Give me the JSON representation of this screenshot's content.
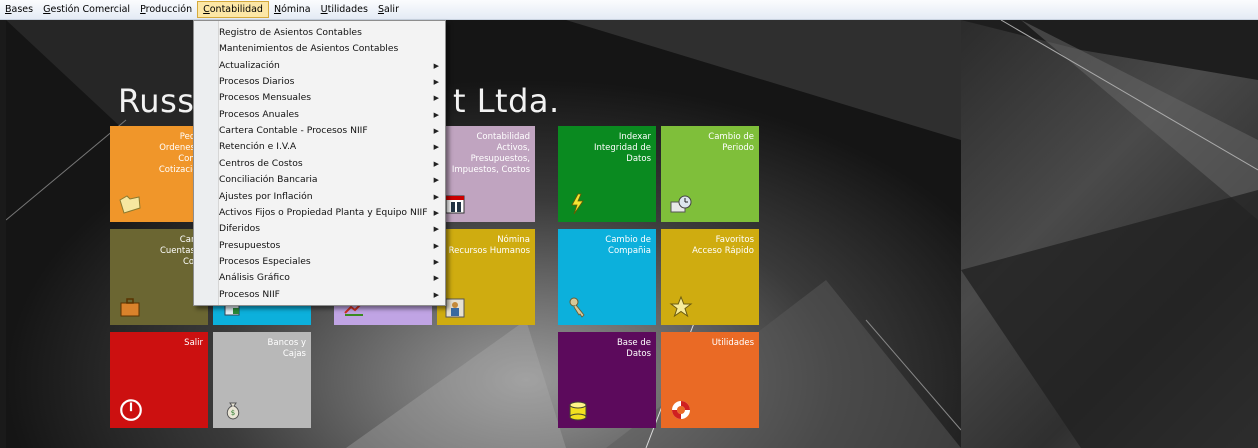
{
  "menubar": {
    "items": [
      {
        "label": "Bases",
        "key": "B"
      },
      {
        "label": "Gestión Comercial",
        "key": "G"
      },
      {
        "label": "Producción",
        "key": "P"
      },
      {
        "label": "Contabilidad",
        "key": "C"
      },
      {
        "label": "Nómina",
        "key": "N"
      },
      {
        "label": "Utilidades",
        "key": "U"
      },
      {
        "label": "Salir",
        "key": "S"
      }
    ],
    "active_index": 3
  },
  "company": {
    "title_visible_left": "Russo",
    "title_visible_right": "t Ltda."
  },
  "contabilidad_menu": {
    "items": [
      {
        "label": "Registro de Asientos Contables",
        "submenu": false
      },
      {
        "label": "Mantenimientos de Asientos Contables",
        "submenu": false
      },
      {
        "label": "Actualización",
        "submenu": true
      },
      {
        "label": "Procesos Diarios",
        "submenu": true
      },
      {
        "label": "Procesos Mensuales",
        "submenu": true
      },
      {
        "label": "Procesos Anuales",
        "submenu": true
      },
      {
        "label": "Cartera Contable - Procesos NIIF",
        "submenu": true
      },
      {
        "label": "Retención e I.V.A",
        "submenu": true
      },
      {
        "label": "Centros de Costos",
        "submenu": true
      },
      {
        "label": "Conciliación Bancaria",
        "submenu": true
      },
      {
        "label": "Ajustes por Inflación",
        "submenu": true
      },
      {
        "label": "Activos Fijos o Propiedad Planta y Equipo NIIF",
        "submenu": true
      },
      {
        "label": "Diferidos",
        "submenu": true
      },
      {
        "label": "Presupuestos",
        "submenu": true
      },
      {
        "label": "Procesos Especiales",
        "submenu": true
      },
      {
        "label": "Análisis Gráfico",
        "submenu": true
      },
      {
        "label": "Procesos NIIF",
        "submenu": true
      }
    ]
  },
  "tiles": {
    "pedidos": {
      "text": "Pedid\nOrdenes d\nComp\nCotizacion",
      "color": "#f0962a",
      "icon": "folder-icon"
    },
    "contabilidad": {
      "text": "Contabilidad\nActivos,\nPresupuestos,\nImpuestos, Costos",
      "color": "#c0a4c0",
      "icon": "ledger-icon"
    },
    "indexar": {
      "text": "Indexar\nIntegridad de\nDatos",
      "color": "#0a8a20",
      "icon": "lightning-icon"
    },
    "cambio_periodo": {
      "text": "Cambio de\nPeriodo",
      "color": "#7fbf3a",
      "icon": "calendar-clock-icon"
    },
    "cartera": {
      "text": "Carte\nCuentas p\nCobr",
      "color": "#6b6632",
      "icon": "briefcase-icon"
    },
    "nomina": {
      "text": "Nómina\nRecursos Humanos",
      "color": "#cfac10",
      "icon": "employee-icon"
    },
    "cambio_compania": {
      "text": "Cambio de\nCompañia",
      "color": "#0cb0dc",
      "icon": "keys-icon"
    },
    "favoritos": {
      "text": "Favoritos\nAcceso Rápido",
      "color": "#cfac10",
      "icon": "star-icon"
    },
    "salir": {
      "text": "Salir",
      "color": "#cc1010",
      "icon": "power-icon"
    },
    "bancos": {
      "text": "Bancos y\nCajas",
      "color": "#b8b8b8",
      "icon": "money-bag-icon"
    },
    "base_datos": {
      "text": "Base de\nDatos",
      "color": "#5c0a5c",
      "icon": "database-icon"
    },
    "utilidades": {
      "text": "Utilidades",
      "color": "#ea6a25",
      "icon": "lifebuoy-icon"
    },
    "partial_blue": {
      "color": "#0cb0dc",
      "icon": "report-icon"
    },
    "partial_lilac": {
      "color": "#c0a4e4",
      "icon": "chart-icon"
    }
  }
}
